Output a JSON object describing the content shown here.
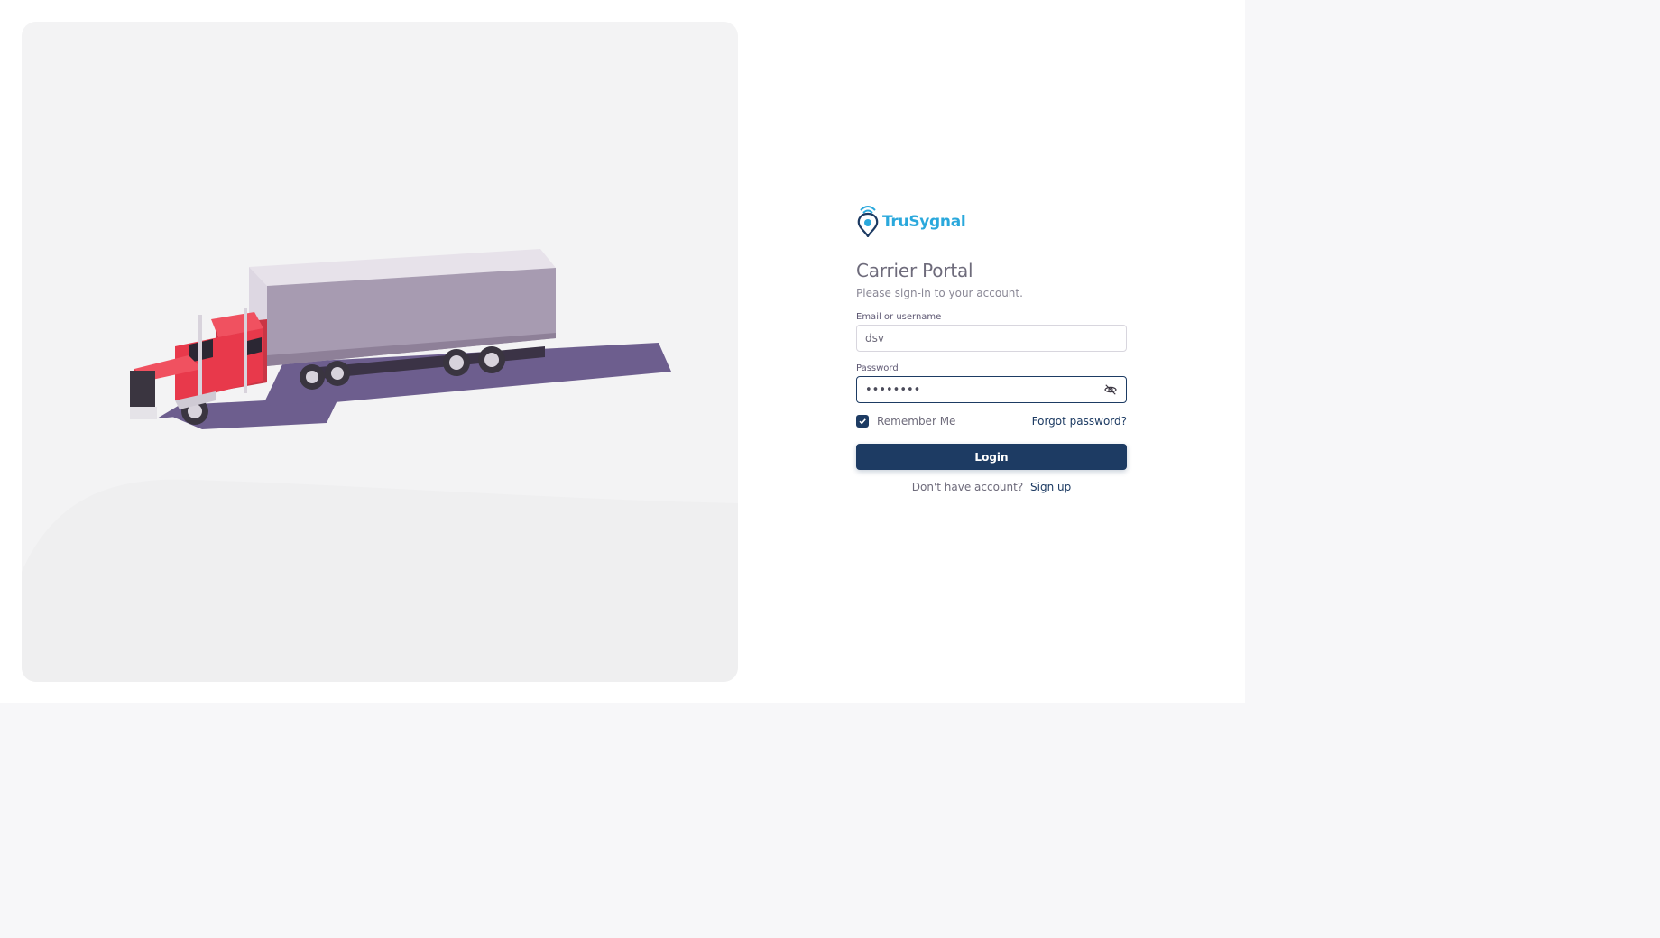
{
  "brand": {
    "name": "TruSygnal",
    "accent_color": "#2aa8dc",
    "primary_color": "#1d3b63"
  },
  "login": {
    "title": "Carrier Portal",
    "subtitle": "Please sign-in to your account.",
    "email_label": "Email or username",
    "email_value": "dsv",
    "password_label": "Password",
    "password_value": "••••••••",
    "remember_label": "Remember Me",
    "remember_checked": true,
    "forgot_label": "Forgot password?",
    "login_label": "Login",
    "signup_prompt": "Don't have account?",
    "signup_label": "Sign up"
  },
  "icons": {
    "logo": "location-pin-signal-icon",
    "password_toggle": "eye-off-icon",
    "checkbox": "check-icon"
  }
}
